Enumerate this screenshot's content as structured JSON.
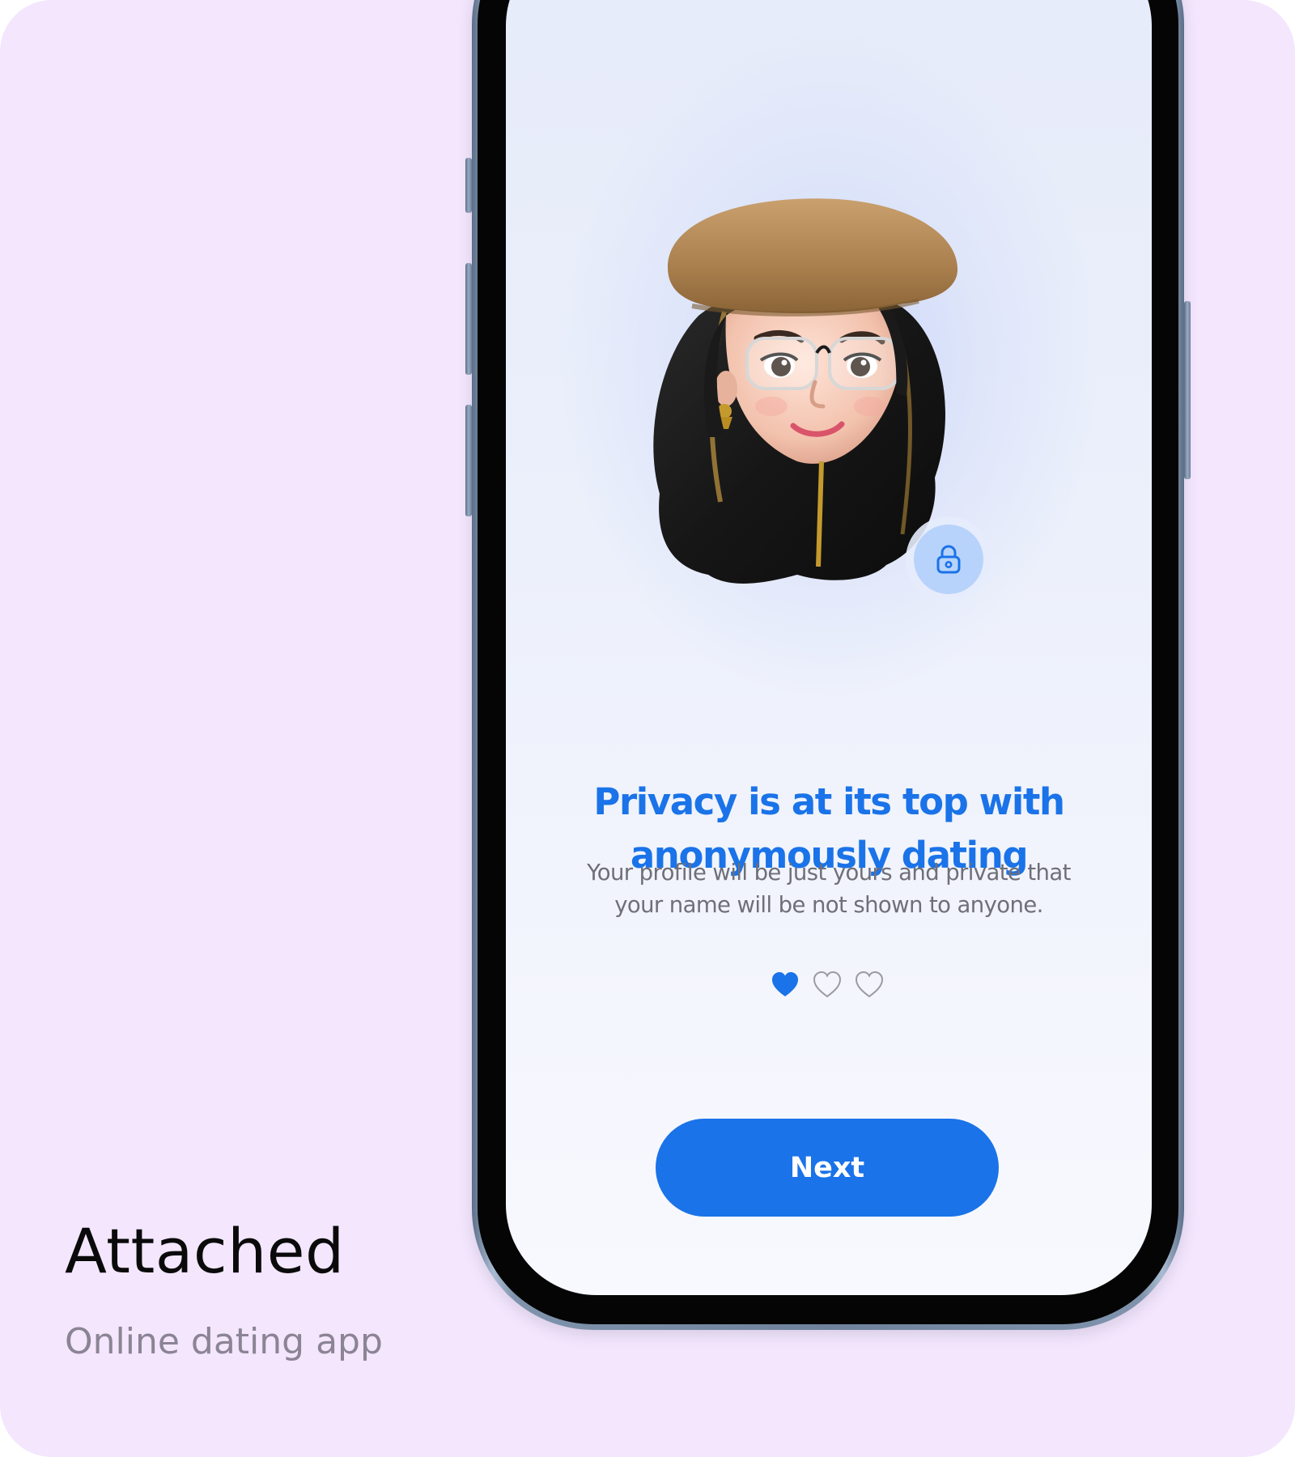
{
  "caption": {
    "title": "Attached",
    "subtitle": "Online dating app"
  },
  "screen": {
    "headline_line1": "Privacy is at its top with",
    "headline_line2": "anonymously dating",
    "body_line1": "Your profile will be just yours and private that",
    "body_line2": "your name will be not shown to anyone.",
    "next_label": "Next",
    "pagination": {
      "total": 3,
      "active_index": 0,
      "icon": "heart-icon"
    },
    "avatar_icon": "memoji-avatar",
    "badge_icon": "lock-icon"
  },
  "colors": {
    "background": "#f3e6fd",
    "accent": "#1a73e8",
    "body_text": "#6f6f78",
    "badge": "#b8d3fb"
  }
}
